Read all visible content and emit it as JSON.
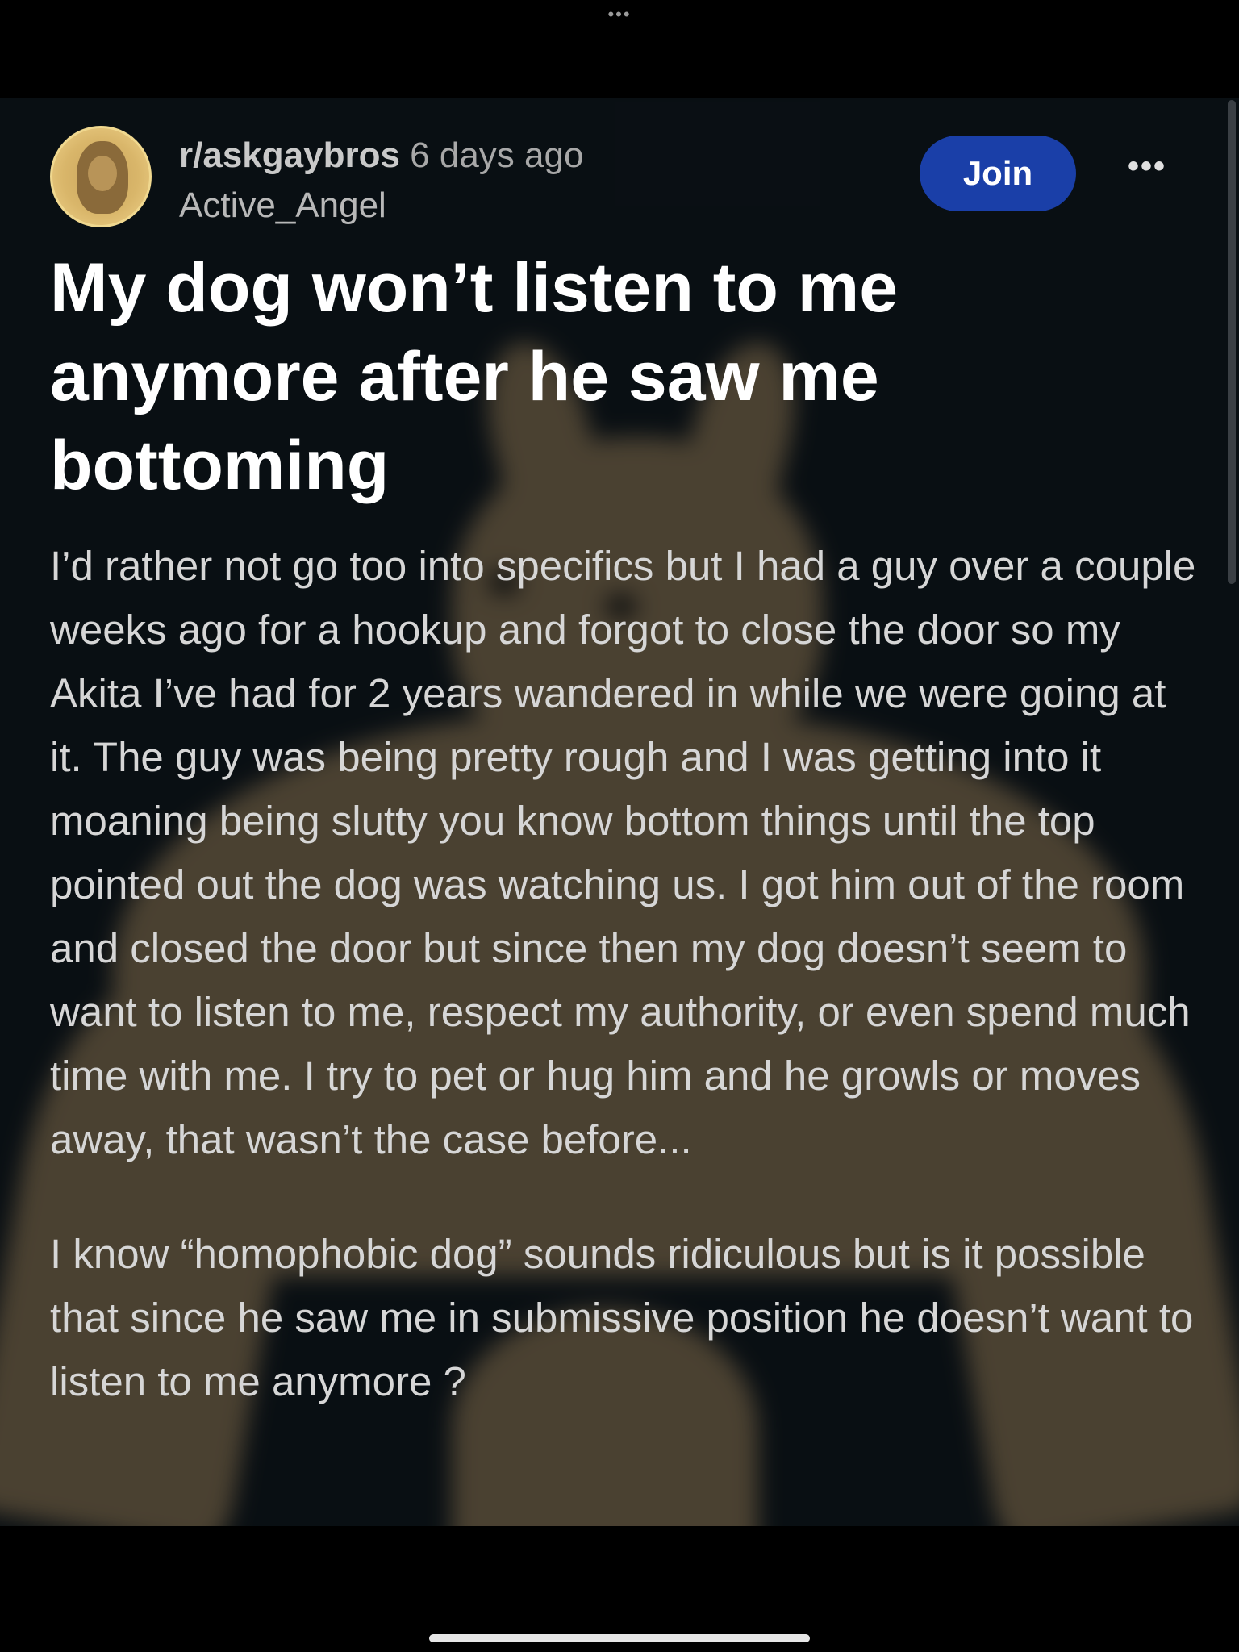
{
  "status_bar": {
    "dots": "•••"
  },
  "post": {
    "subreddit": "r/askgaybros",
    "time": "6 days ago",
    "author": "Active_Angel",
    "join_label": "Join",
    "more_label": "•••",
    "title": "My dog won’t listen to me anymore after he saw me bottoming",
    "paragraphs": [
      "I’d rather not go too into specifics but I had a guy over a couple weeks ago for a hookup and forgot to close the door so my Akita I’ve had for 2 years wandered in while we were going at it. The guy was being pretty rough and I was getting into it moaning being slutty you know bottom things until the top pointed out the dog was watching us. I got him out of the room and closed the door but since then my dog doesn’t seem to want to listen to me, respect my authority, or even spend much time with me. I try to pet or hug him and he growls or moves away, that wasn’t the case before...",
      "I know “homophobic dog” sounds ridiculous but is it possible that since he saw me in submissive position he doesn’t want to listen to me anymore ?"
    ]
  },
  "colors": {
    "background": "#0b1116",
    "join_button": "#1a3fa8",
    "title_text": "#ffffff",
    "body_text": "#d6d6d6"
  },
  "icons": {
    "avatar": "bust-statue-avatar",
    "more": "more-options-icon"
  }
}
